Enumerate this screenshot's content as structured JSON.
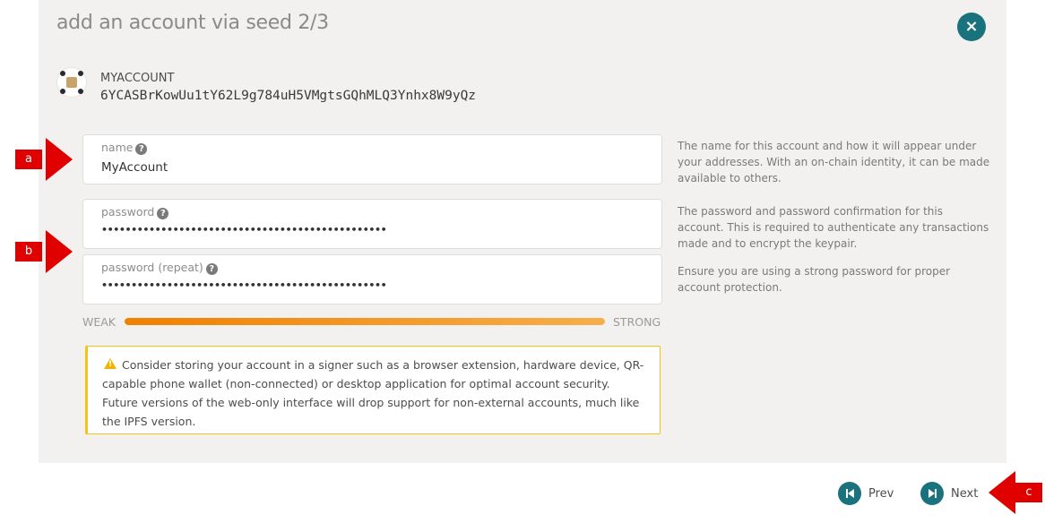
{
  "modal": {
    "title": "add an account via seed 2/3",
    "close_label": "×"
  },
  "account": {
    "name": "MYACCOUNT",
    "address": "6YCASBrKowUu1tY62L9g784uH5VMgtsGQhMLQ3Ynhx8W9yQz"
  },
  "form": {
    "name_field": {
      "label": "name",
      "value": "MyAccount"
    },
    "password_field": {
      "label": "password",
      "value": "••••••••••••••••••••••••••••••••••••••••••••••••"
    },
    "password_repeat_field": {
      "label": "password (repeat)",
      "value": "••••••••••••••••••••••••••••••••••••••••••••••••"
    },
    "help_icon": "?"
  },
  "help": {
    "name": "The name for this account and how it will appear under your addresses. With an on-chain identity, it can be made available to others.",
    "password": "The password and password confirmation for this account. This is required to authenticate any transactions made and to encrypt the keypair.",
    "password_repeat": "Ensure you are using a strong password for proper account protection."
  },
  "strength": {
    "weak_label": "WEAK",
    "strong_label": "STRONG",
    "level": 1.0,
    "colors": [
      "#f08000",
      "#f7ae4a"
    ]
  },
  "warning": {
    "text": "Consider storing your account in a signer such as a browser extension, hardware device, QR-capable phone wallet (non-connected) or desktop application for optimal account security. Future versions of the web-only interface will drop support for non-external accounts, much like the IPFS version.",
    "icon": "warning-triangle-icon"
  },
  "footer": {
    "prev_label": "Prev",
    "next_label": "Next"
  },
  "callouts": {
    "a": "a",
    "b": "b",
    "c": "c"
  },
  "colors": {
    "accent": "#19727c",
    "callout": "#e00000",
    "warning_border": "#f0c419"
  }
}
